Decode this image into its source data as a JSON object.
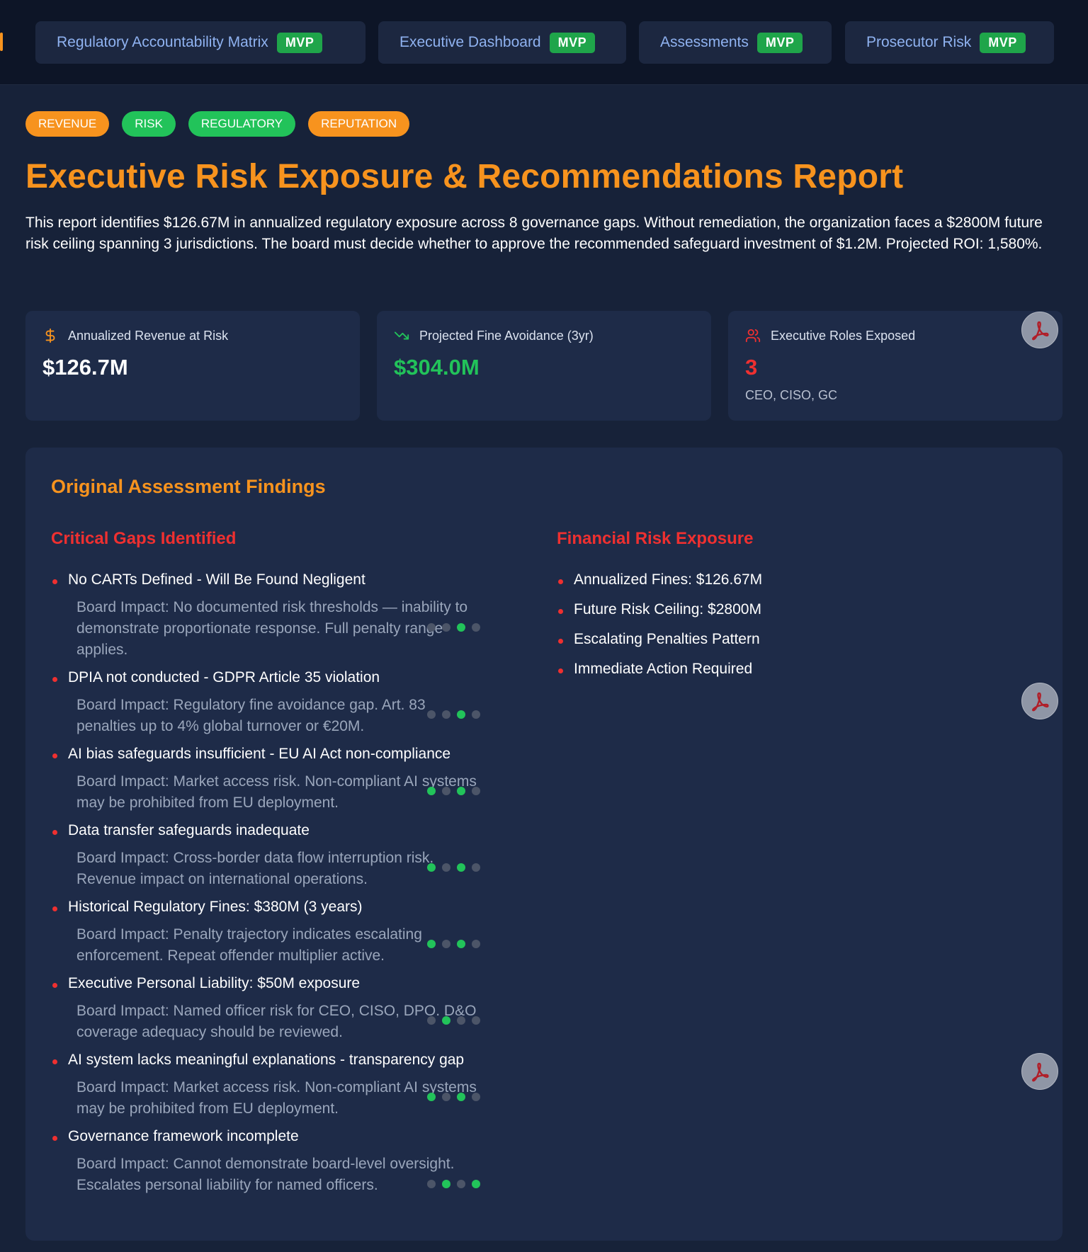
{
  "nav": {
    "tabs": [
      {
        "label": "Regulatory Accountability Matrix",
        "badge": "MVP"
      },
      {
        "label": "Executive Dashboard",
        "badge": "MVP"
      },
      {
        "label": "Assessments",
        "badge": "MVP"
      },
      {
        "label": "Prosecutor Risk",
        "badge": "MVP"
      }
    ]
  },
  "tags": [
    "REVENUE",
    "RISK",
    "REGULATORY",
    "REPUTATION"
  ],
  "report": {
    "title": "Executive Risk Exposure & Recommendations Report",
    "intro": "This report identifies $126.67M in annualized regulatory exposure across 8 governance gaps. Without remediation, the organization faces a $2800M future risk ceiling spanning 3 jurisdictions. The board must decide whether to approve the recommended safeguard investment of $1.2M. Projected ROI: 1,580%."
  },
  "cards": [
    {
      "label": "Annualized Revenue at Risk",
      "value": "$126.7M",
      "icon": "dollar-icon",
      "color": "#ffffff"
    },
    {
      "label": "Projected Fine Avoidance (3yr)",
      "value": "$304.0M",
      "icon": "trending-down-icon",
      "color": "#22c35a"
    },
    {
      "label": "Executive Roles Exposed",
      "value": "3",
      "sub": "CEO, CISO, GC",
      "icon": "users-icon",
      "color": "#ef3030"
    }
  ],
  "findings": {
    "title": "Original Assessment Findings",
    "gaps_title": "Critical Gaps Identified",
    "gaps": [
      {
        "title": "No CARTs Defined - Will Be Found Negligent",
        "impact": "Board Impact: No documented risk thresholds — inability to demonstrate proportionate response. Full penalty range applies.",
        "dots": [
          false,
          false,
          true,
          false
        ]
      },
      {
        "title": "DPIA not conducted - GDPR Article 35 violation",
        "impact": "Board Impact: Regulatory fine avoidance gap. Art. 83 penalties up to 4% global turnover or €20M.",
        "dots": [
          false,
          false,
          true,
          false
        ]
      },
      {
        "title": "AI bias safeguards insufficient - EU AI Act non-compliance",
        "impact": "Board Impact: Market access risk. Non-compliant AI systems may be prohibited from EU deployment.",
        "dots": [
          true,
          false,
          true,
          false
        ]
      },
      {
        "title": "Data transfer safeguards inadequate",
        "impact": "Board Impact: Cross-border data flow interruption risk. Revenue impact on international operations.",
        "dots": [
          true,
          false,
          true,
          false
        ]
      },
      {
        "title": "Historical Regulatory Fines: $380M (3 years)",
        "impact": "Board Impact: Penalty trajectory indicates escalating enforcement. Repeat offender multiplier active.",
        "dots": [
          true,
          false,
          true,
          false
        ]
      },
      {
        "title": "Executive Personal Liability: $50M exposure",
        "impact": "Board Impact: Named officer risk for CEO, CISO, DPO. D&O coverage adequacy should be reviewed.",
        "dots": [
          false,
          true,
          false,
          false
        ]
      },
      {
        "title": "AI system lacks meaningful explanations - transparency gap",
        "impact": "Board Impact: Market access risk. Non-compliant AI systems may be prohibited from EU deployment.",
        "dots": [
          true,
          false,
          true,
          false
        ]
      },
      {
        "title": "Governance framework incomplete",
        "impact": "Board Impact: Cannot demonstrate board-level oversight. Escalates personal liability for named officers.",
        "dots": [
          false,
          true,
          false,
          true
        ]
      }
    ],
    "financial_title": "Financial Risk Exposure",
    "financial": [
      "Annualized Fines: $126.67M",
      "Future Risk Ceiling: $2800M",
      "Escalating Penalties Pattern",
      "Immediate Action Required"
    ]
  },
  "colors": {
    "accent": "#f7931e",
    "success": "#22c35a",
    "danger": "#ef3030",
    "mvp": "#1fa54a"
  }
}
